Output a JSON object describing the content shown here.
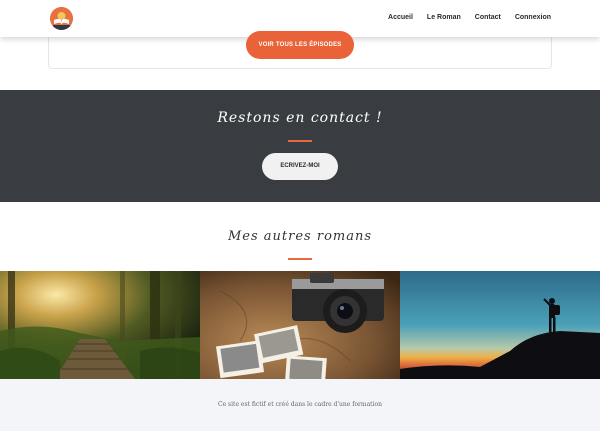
{
  "header": {
    "logo_icon": "open-book-sunset-logo",
    "nav": [
      "Accueil",
      "Le Roman",
      "Contact",
      "Connexion"
    ]
  },
  "episodes": {
    "button_label": "VOIR TOUS LES ÉPISODES"
  },
  "contact": {
    "title": "Restons en contact !",
    "button_label": "ECRIVEZ-MOI"
  },
  "novels": {
    "title": "Mes autres romans",
    "images": [
      "forest-boardwalk-image",
      "camera-vintage-photos-image",
      "hiker-sunset-silhouette-image"
    ]
  },
  "footer": {
    "text": "Ce site est fictif et créé dans le cadre d'une formation"
  },
  "colors": {
    "accent": "#ea6338",
    "band": "#393d42",
    "footer": "#f4f5f8"
  }
}
